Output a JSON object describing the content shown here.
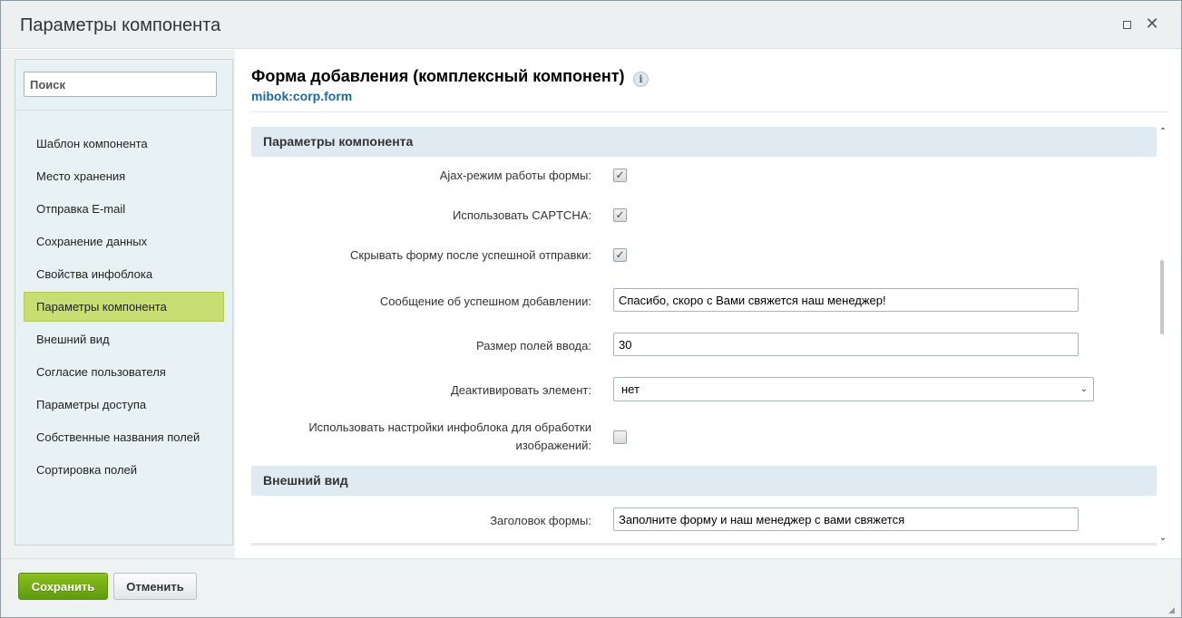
{
  "window": {
    "title": "Параметры компонента",
    "maximize_icon": "maximize-icon",
    "close_icon": "close-icon",
    "close_glyph": "✕"
  },
  "sidebar": {
    "search_placeholder": "Поиск",
    "items": [
      {
        "label": "Шаблон компонента",
        "active": false
      },
      {
        "label": "Место хранения",
        "active": false
      },
      {
        "label": "Отправка E-mail",
        "active": false
      },
      {
        "label": "Сохранение данных",
        "active": false
      },
      {
        "label": "Свойства инфоблока",
        "active": false
      },
      {
        "label": "Параметры компонента",
        "active": true
      },
      {
        "label": "Внешний вид",
        "active": false
      },
      {
        "label": "Согласие пользователя",
        "active": false
      },
      {
        "label": "Параметры доступа",
        "active": false
      },
      {
        "label": "Собственные названия полей",
        "active": false
      },
      {
        "label": "Сортировка полей",
        "active": false
      }
    ]
  },
  "component": {
    "title": "Форма добавления (комплексный компонент)",
    "code": "mibok:corp.form",
    "info_glyph": "i"
  },
  "sections": {
    "params": {
      "title": "Параметры компонента",
      "ajax_label": "Ajax-режим работы формы:",
      "ajax_checked": true,
      "captcha_label": "Использовать CAPTCHA:",
      "captcha_checked": true,
      "hide_label": "Скрывать форму после успешной отправки:",
      "hide_checked": true,
      "success_msg_label": "Сообщение об успешном добавлении:",
      "success_msg_value": "Спасибо, скоро с Вами свяжется наш менеджер!",
      "input_size_label": "Размер полей ввода:",
      "input_size_value": "30",
      "deactivate_label": "Деактивировать элемент:",
      "deactivate_value": "нет",
      "iblock_settings_label_line1": "Использовать настройки инфоблока для обработки",
      "iblock_settings_label_line2": "изображений:",
      "iblock_settings_checked": false
    },
    "appearance": {
      "title": "Внешний вид",
      "form_title_label": "Заголовок формы:",
      "form_title_value": "Заполните форму и наш менеджер с вами свяжется"
    }
  },
  "check_glyph": "✓",
  "footer": {
    "save_label": "Сохранить",
    "cancel_label": "Отменить"
  },
  "colors": {
    "accent_green": "#6aa714",
    "active_nav": "#c8dd72",
    "section_bg": "#e0eaf3",
    "link_blue": "#2167a0"
  }
}
